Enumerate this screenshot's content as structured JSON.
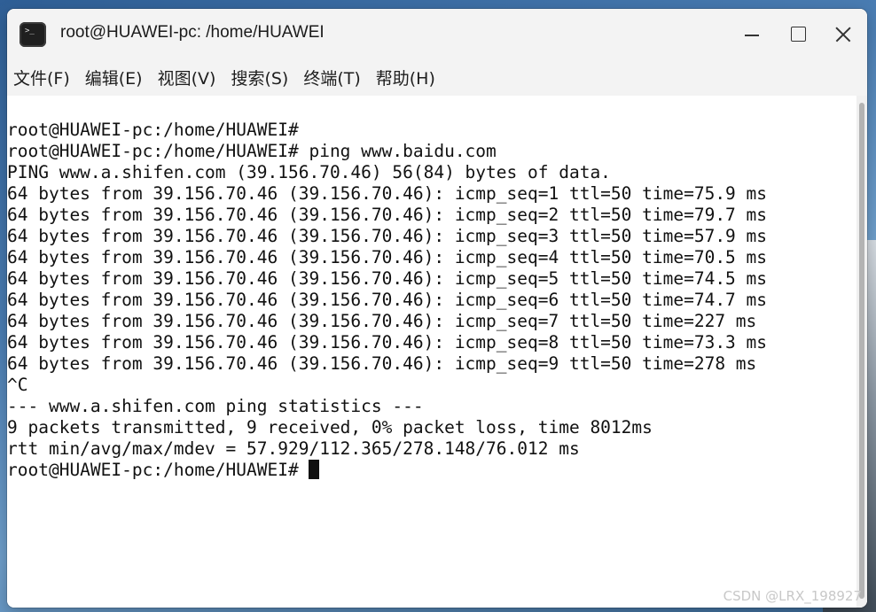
{
  "window": {
    "title": "root@HUAWEI-pc: /home/HUAWEI",
    "icon": "terminal-icon",
    "controls": [
      "minimize-icon",
      "maximize-icon",
      "close-icon"
    ]
  },
  "menu": {
    "items": [
      "文件(F)",
      "编辑(E)",
      "视图(V)",
      "搜索(S)",
      "终端(T)",
      "帮助(H)"
    ]
  },
  "terminal": {
    "lines": [
      "root@HUAWEI-pc:/home/HUAWEI#",
      "root@HUAWEI-pc:/home/HUAWEI# ping www.baidu.com",
      "PING www.a.shifen.com (39.156.70.46) 56(84) bytes of data.",
      "64 bytes from 39.156.70.46 (39.156.70.46): icmp_seq=1 ttl=50 time=75.9 ms",
      "64 bytes from 39.156.70.46 (39.156.70.46): icmp_seq=2 ttl=50 time=79.7 ms",
      "64 bytes from 39.156.70.46 (39.156.70.46): icmp_seq=3 ttl=50 time=57.9 ms",
      "64 bytes from 39.156.70.46 (39.156.70.46): icmp_seq=4 ttl=50 time=70.5 ms",
      "64 bytes from 39.156.70.46 (39.156.70.46): icmp_seq=5 ttl=50 time=74.5 ms",
      "64 bytes from 39.156.70.46 (39.156.70.46): icmp_seq=6 ttl=50 time=74.7 ms",
      "64 bytes from 39.156.70.46 (39.156.70.46): icmp_seq=7 ttl=50 time=227 ms",
      "64 bytes from 39.156.70.46 (39.156.70.46): icmp_seq=8 ttl=50 time=73.3 ms",
      "64 bytes from 39.156.70.46 (39.156.70.46): icmp_seq=9 ttl=50 time=278 ms",
      "^C",
      "--- www.a.shifen.com ping statistics ---",
      "9 packets transmitted, 9 received, 0% packet loss, time 8012ms",
      "rtt min/avg/max/mdev = 57.929/112.365/278.148/76.012 ms"
    ],
    "prompt": "root@HUAWEI-pc:/home/HUAWEI# "
  },
  "watermark": "CSDN @LRX_198927"
}
